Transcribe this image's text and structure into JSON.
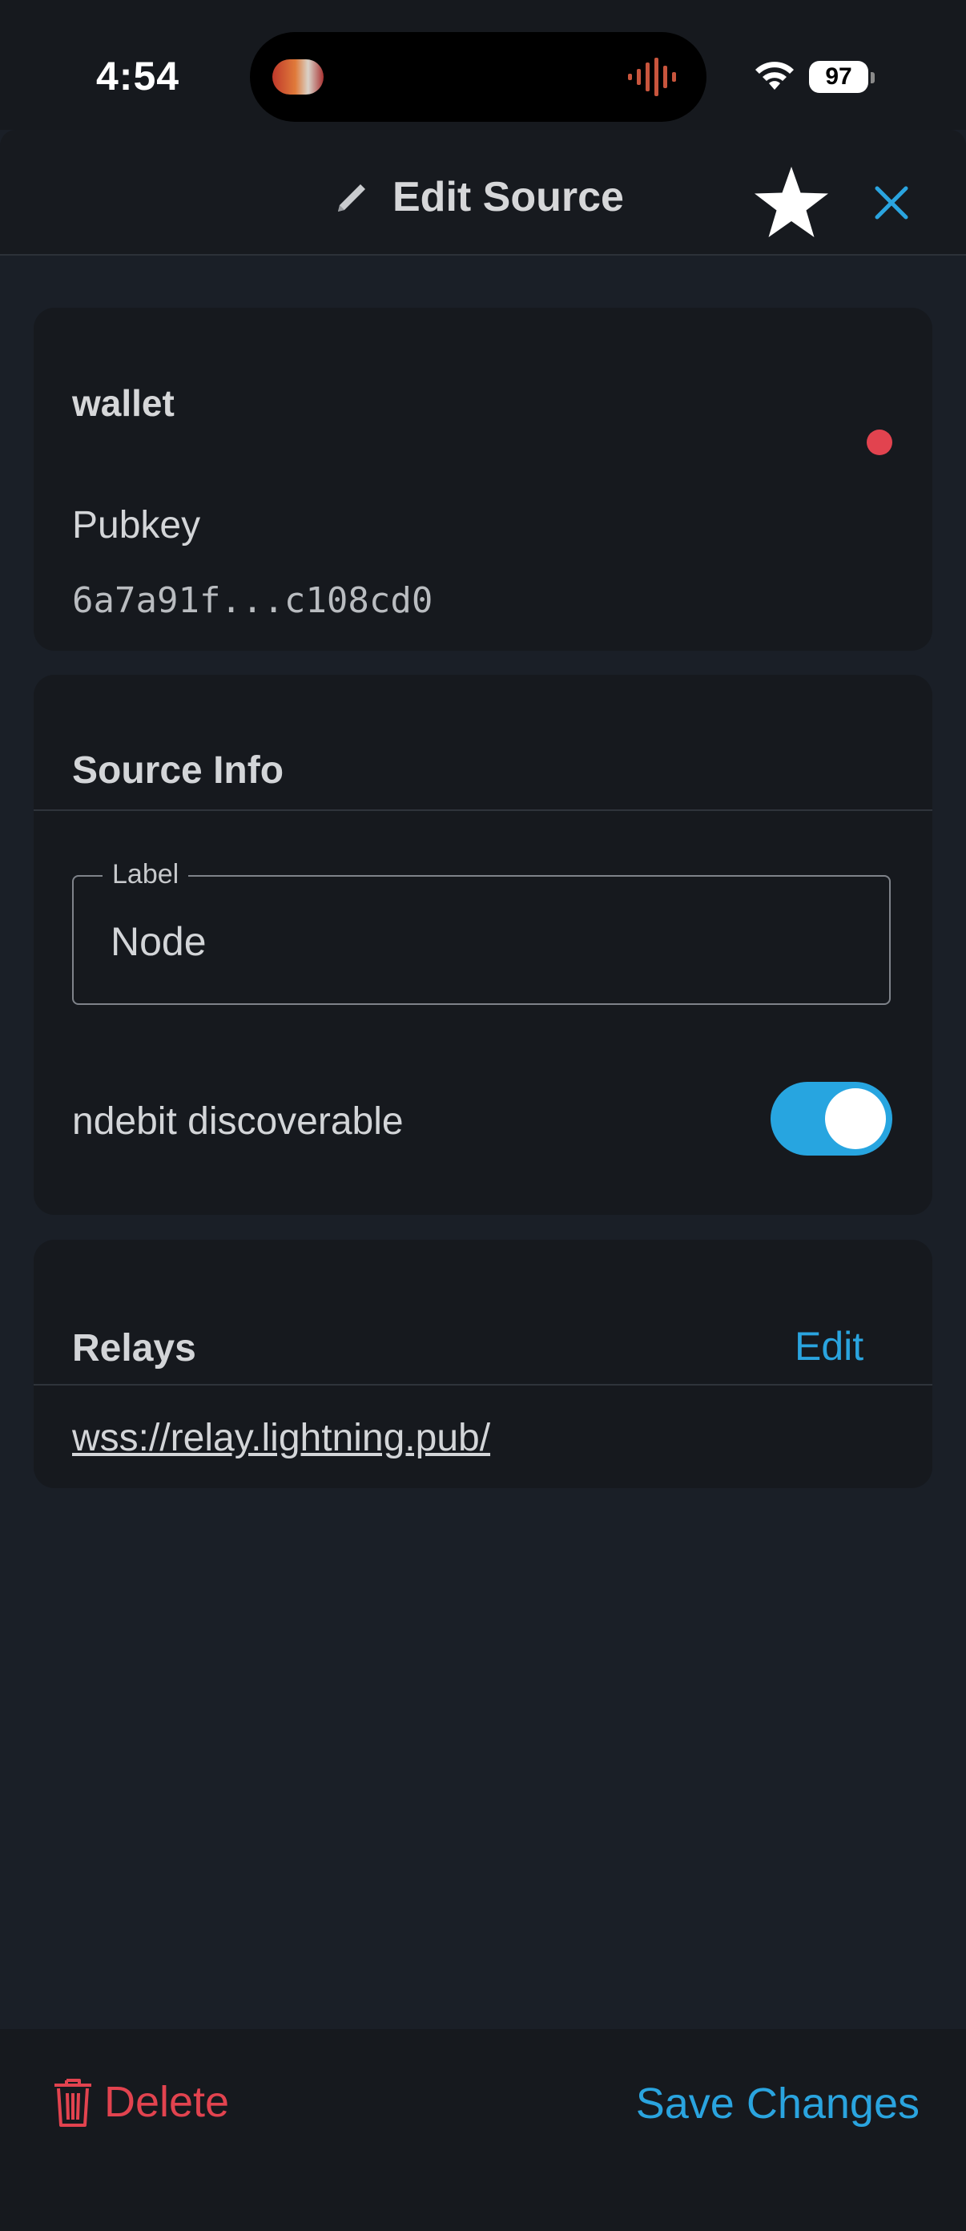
{
  "status_bar": {
    "time": "4:54",
    "battery": "97"
  },
  "header": {
    "title": "Edit Source"
  },
  "wallet_card": {
    "name": "wallet",
    "status_color": "#e2434f",
    "pubkey_label": "Pubkey",
    "pubkey_value": "6a7a91f...c108cd0"
  },
  "source_info": {
    "title": "Source Info",
    "label_field": {
      "legend": "Label",
      "value": "Node"
    },
    "discoverable": {
      "label": "ndebit discoverable",
      "enabled": true
    }
  },
  "relays": {
    "title": "Relays",
    "edit_label": "Edit",
    "items": [
      "wss://relay.lightning.pub/"
    ]
  },
  "footer": {
    "delete_label": "Delete",
    "save_label": "Save Changes"
  },
  "colors": {
    "accent": "#2aa4df",
    "danger": "#e2434f",
    "background": "#1a1f27",
    "card": "#16191e"
  }
}
